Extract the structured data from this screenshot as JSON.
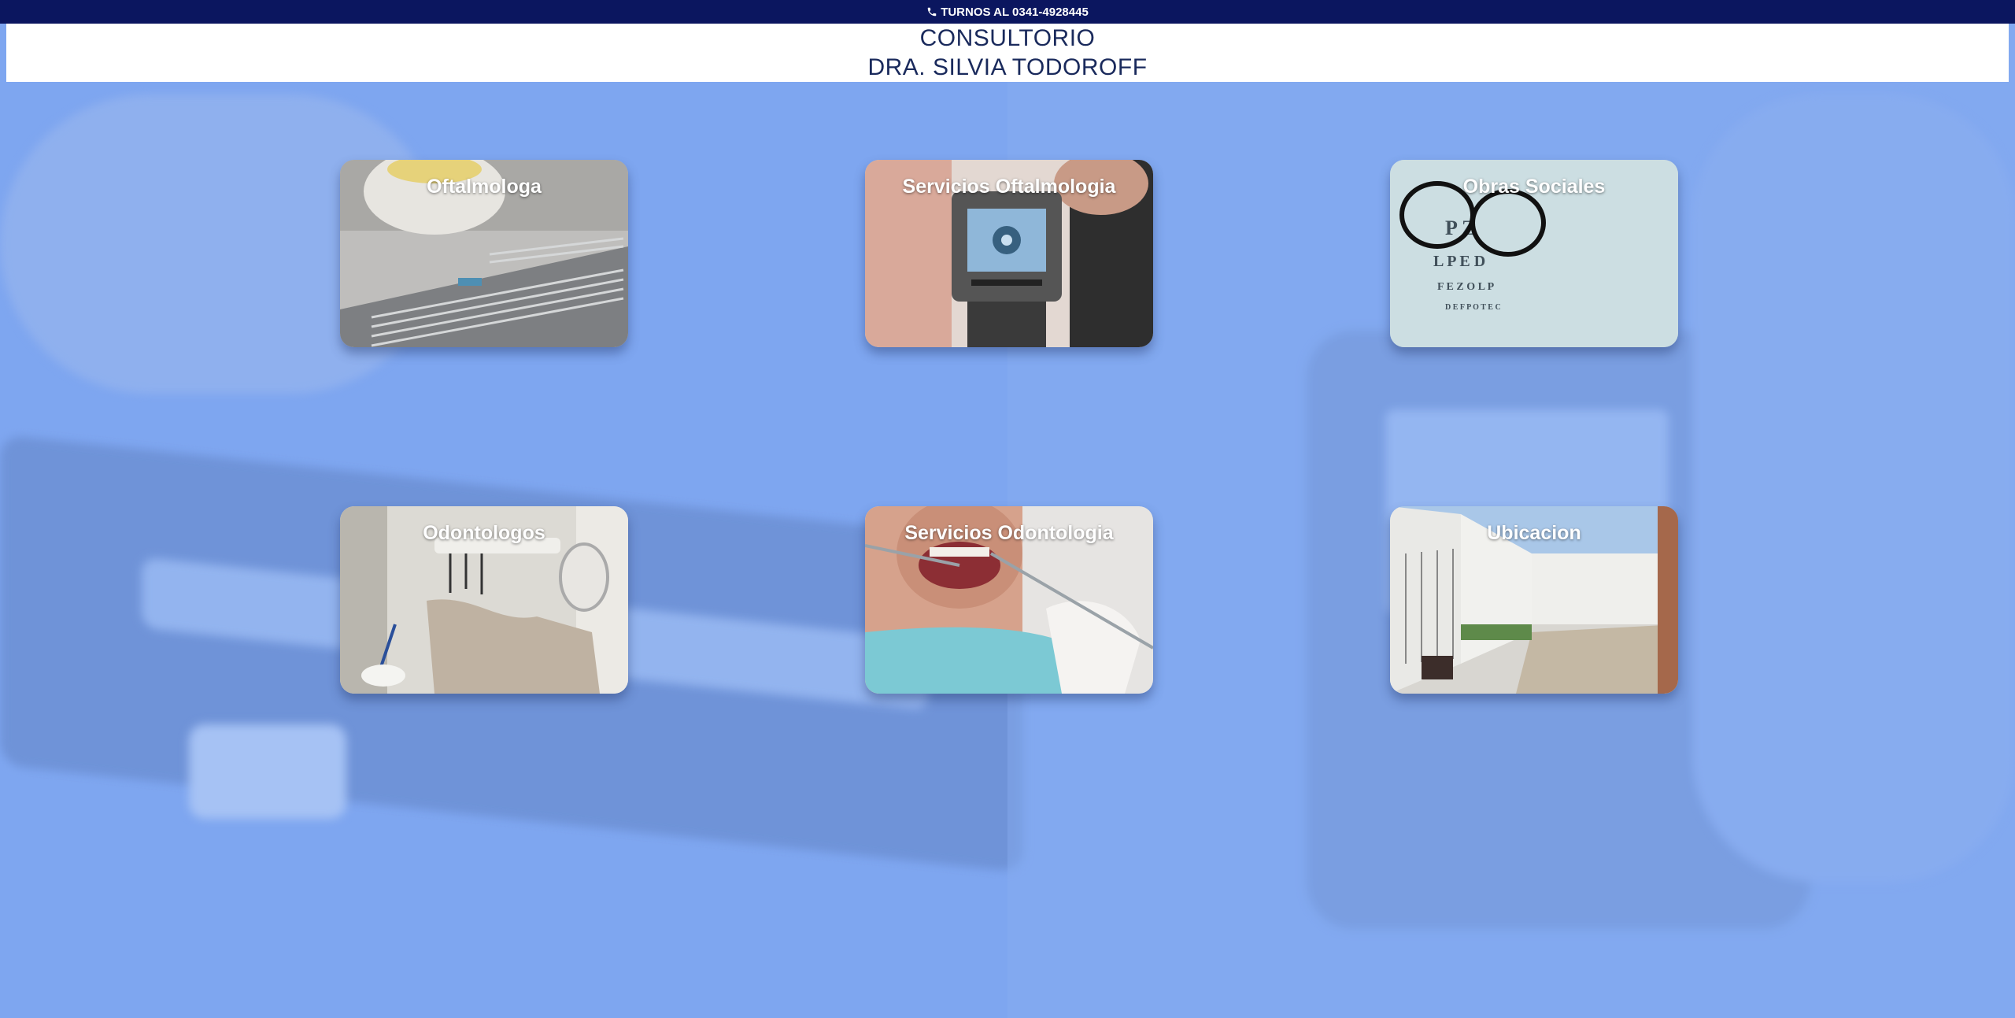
{
  "topbar": {
    "phone_text": "TURNOS AL 0341-4928445"
  },
  "header": {
    "line1": "CONSULTORIO",
    "line2": "DRA. SILVIA TODOROFF"
  },
  "cards": [
    {
      "label": "Oftalmologa"
    },
    {
      "label": "Servicios Oftalmologia"
    },
    {
      "label": "Obras Sociales"
    },
    {
      "label": "Odontologos"
    },
    {
      "label": "Servicios Odontologia"
    },
    {
      "label": "Ubicacion"
    }
  ],
  "colors": {
    "topbar": "#0b165f",
    "header_text": "#1a2a5c",
    "page_background": "#7ea6f0"
  }
}
